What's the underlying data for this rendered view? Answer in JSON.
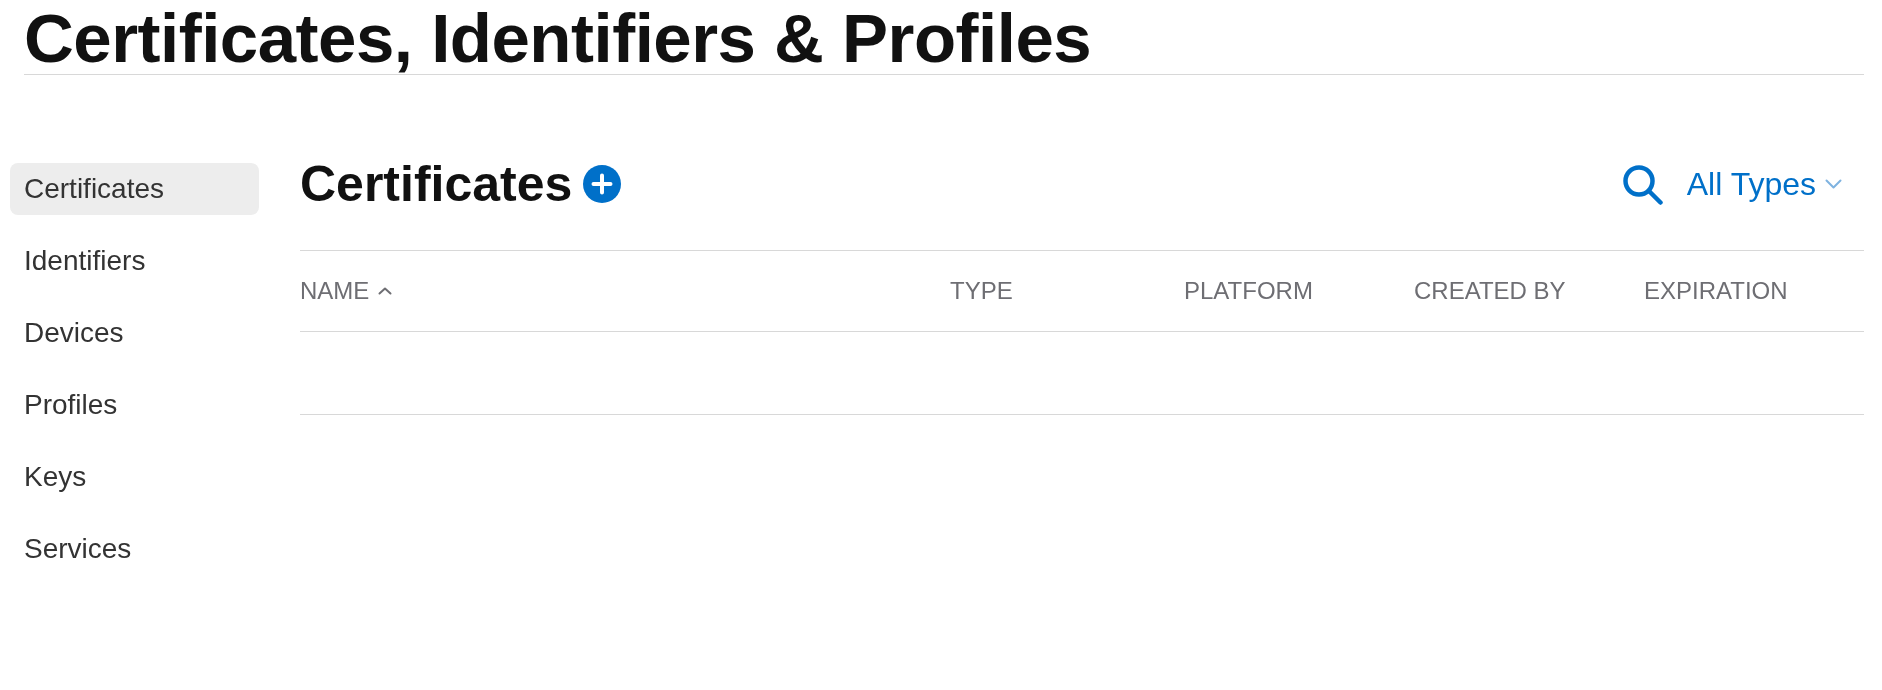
{
  "page_title": "Certificates, Identifiers & Profiles",
  "sidebar": {
    "items": [
      {
        "label": "Certificates",
        "selected": true
      },
      {
        "label": "Identifiers",
        "selected": false
      },
      {
        "label": "Devices",
        "selected": false
      },
      {
        "label": "Profiles",
        "selected": false
      },
      {
        "label": "Keys",
        "selected": false
      },
      {
        "label": "Services",
        "selected": false
      }
    ]
  },
  "main": {
    "heading": "Certificates",
    "type_filter": {
      "value": "All Types"
    }
  },
  "table": {
    "columns": [
      {
        "label": "NAME",
        "sorted": true
      },
      {
        "label": "TYPE",
        "sorted": false
      },
      {
        "label": "PLATFORM",
        "sorted": false
      },
      {
        "label": "CREATED BY",
        "sorted": false
      },
      {
        "label": "EXPIRATION",
        "sorted": false
      }
    ]
  }
}
